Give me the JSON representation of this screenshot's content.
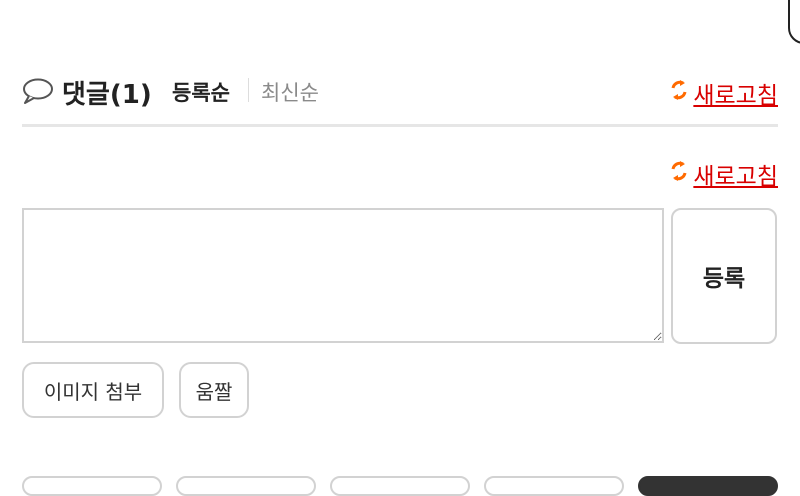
{
  "comments": {
    "title": "댓글(1)",
    "sort_options": [
      "등록순",
      "최신순"
    ],
    "active_sort": "등록순",
    "refresh_label": "새로고침"
  },
  "composer": {
    "textarea_value": "",
    "submit_label": "등록",
    "attach_image_label": "이미지 첨부",
    "gif_label": "움짤"
  },
  "colors": {
    "refresh": "#d80000",
    "refresh_icon": "#ff6a00",
    "border": "#d2d2d2",
    "muted_text": "#8a8a8a"
  },
  "icons": {
    "comment": "speech-bubble-icon",
    "refresh": "refresh-arrows-icon"
  }
}
